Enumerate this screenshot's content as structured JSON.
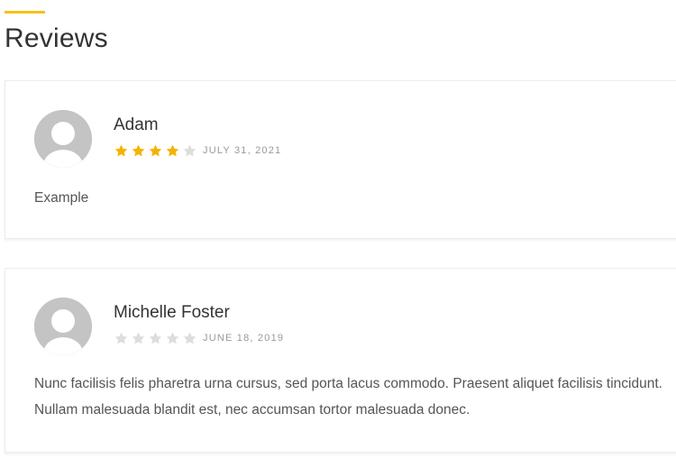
{
  "section": {
    "title": "Reviews",
    "accent_color": "#f5c116"
  },
  "reviews": [
    {
      "name": "Adam",
      "rating": 4,
      "rating_max": 5,
      "date": "JULY 31, 2021",
      "body": "Example",
      "avatar_icon": "user-placeholder-icon"
    },
    {
      "name": "Michelle Foster",
      "rating": 0,
      "rating_max": 5,
      "date": "JUNE 18, 2019",
      "body": "Nunc facilisis felis pharetra urna cursus, sed porta lacus commodo. Praesent aliquet facilisis tincidunt. Nullam malesuada blandit est, nec accumsan tortor malesuada donec.",
      "avatar_icon": "user-placeholder-icon"
    }
  ],
  "colors": {
    "star_filled": "#f5b301",
    "star_empty": "#dddddd",
    "avatar_bg": "#c4c4c4"
  }
}
